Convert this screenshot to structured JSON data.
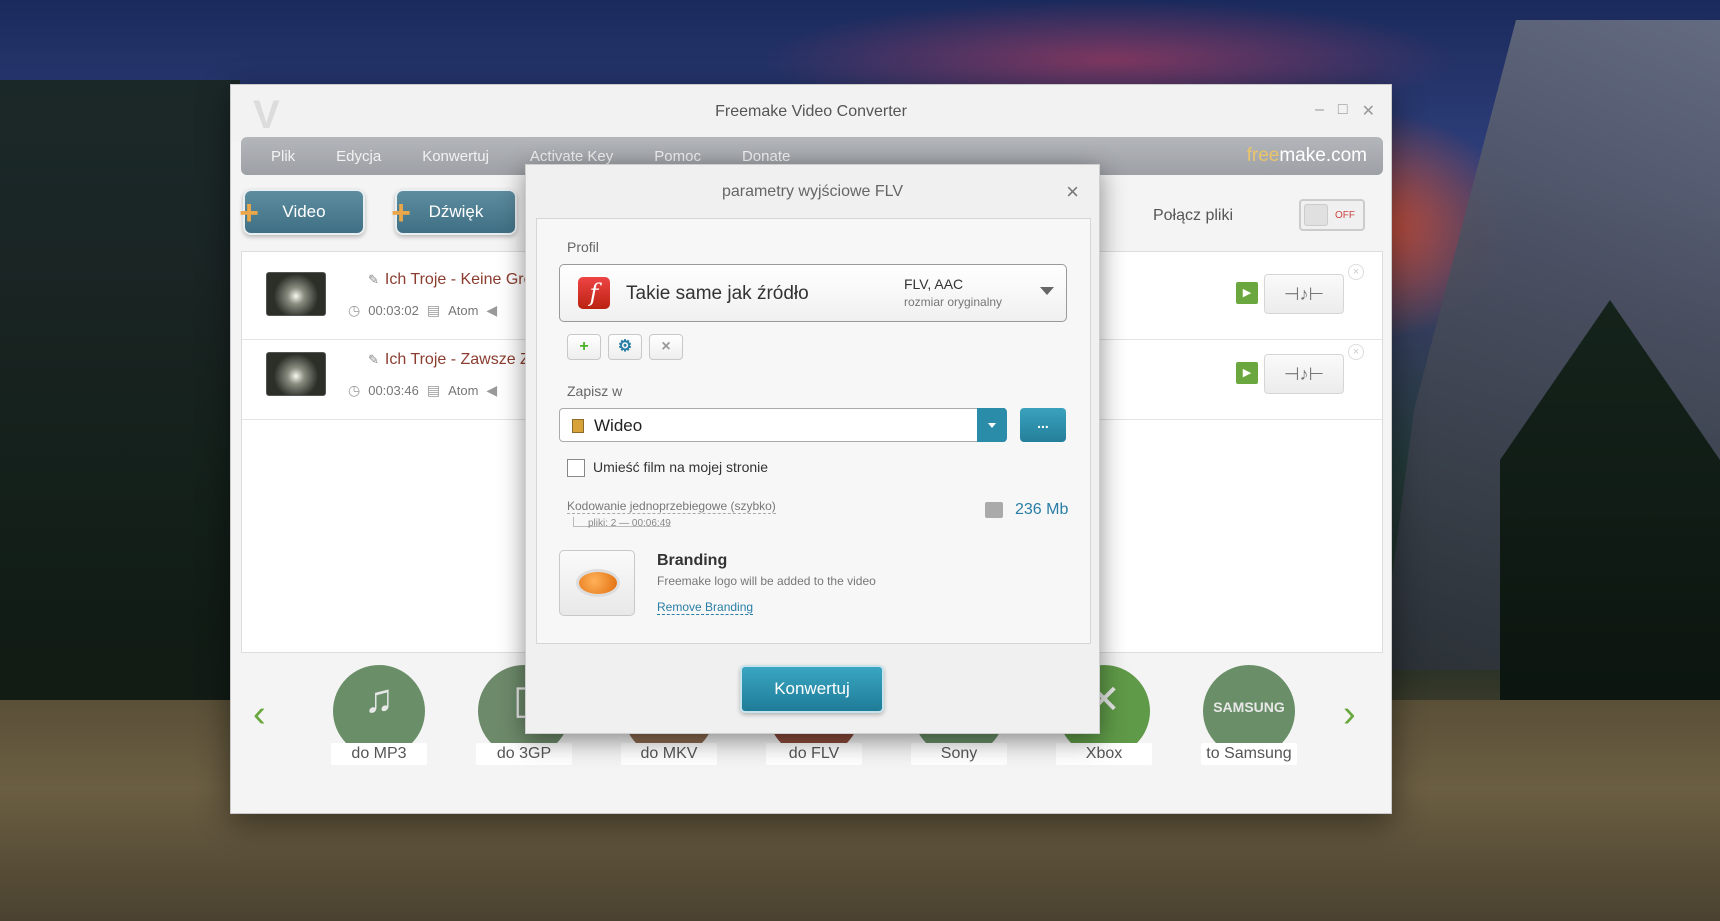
{
  "window": {
    "title": "Freemake Video Converter",
    "controls": [
      "–",
      "□",
      "✕"
    ]
  },
  "menu": {
    "items": [
      "Plik",
      "Edycja",
      "Konwertuj",
      "Activate Key",
      "Pomoc",
      "Donate"
    ],
    "brand_prefix": "free",
    "brand_suffix": "make.com"
  },
  "toolbar": {
    "video_label": "Video",
    "audio_label": "Dźwięk",
    "merge_label": "Połącz pliki",
    "merge_state": "OFF"
  },
  "files": [
    {
      "title": "Ich Troje - Keine Grenze",
      "duration": "00:03:02",
      "codec": "Atom"
    },
    {
      "title": "Ich Troje - Zawsze Z Tob",
      "duration": "00:03:46",
      "codec": "Atom"
    }
  ],
  "formats": [
    "do MP3",
    "do 3GP",
    "do MKV",
    "do FLV",
    "Sony",
    "Xbox",
    "to Samsung"
  ],
  "dialog": {
    "title": "parametry wyjściowe FLV",
    "profile_label": "Profil",
    "profile_name": "Takie same jak źródło",
    "profile_format": "FLV, AAC",
    "profile_size": "rozmiar oryginalny",
    "save_label": "Zapisz w",
    "save_value": "Wideo",
    "browse_label": "...",
    "embed_label": "Umieść film na mojej stronie",
    "encoding_label": "Kodowanie jednoprzebiegowe (szybko)",
    "encoding_sub": "pliki: 2 — 00:06:49",
    "output_size": "236 Mb",
    "branding_title": "Branding",
    "branding_desc": "Freemake logo will be added to the video",
    "branding_link": "Remove Branding",
    "convert_label": "Konwertuj"
  },
  "colors": {
    "accent": "#247f9a",
    "brand_orange": "#e9c46a",
    "play_green": "#6aa83f",
    "title_red": "#8b3d2f"
  }
}
